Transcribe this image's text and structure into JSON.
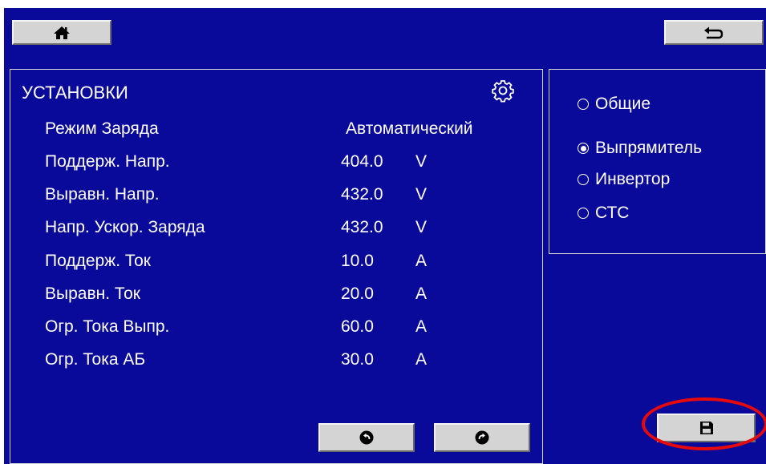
{
  "header": {
    "home_icon": "home-icon",
    "back_icon": "back-arrow-icon"
  },
  "settings": {
    "title": "УСТАНОВКИ",
    "gear_icon": "gear-icon",
    "rows": [
      {
        "label": "Режим Заряда",
        "value": "Автоматический",
        "unit": ""
      },
      {
        "label": "Поддерж. Напр.",
        "value": "404.0",
        "unit": "V"
      },
      {
        "label": "Выравн. Напр.",
        "value": "432.0",
        "unit": "V"
      },
      {
        "label": "Напр. Ускор. Заряда",
        "value": "432.0",
        "unit": "V"
      },
      {
        "label": "Поддерж. Ток",
        "value": "10.0",
        "unit": "A"
      },
      {
        "label": "Выравн. Ток",
        "value": "20.0",
        "unit": "A"
      },
      {
        "label": "Огр. Тока Выпр.",
        "value": "60.0",
        "unit": "A"
      },
      {
        "label": "Огр. Тока АБ",
        "value": "30.0",
        "unit": "A"
      }
    ],
    "prev_icon": "arrow-left-circle-icon",
    "next_icon": "arrow-right-circle-icon"
  },
  "categories": {
    "selected": "Выпрямитель",
    "options": [
      {
        "label": "Общие",
        "selected": false
      },
      {
        "label": "Выпрямитель",
        "selected": true
      },
      {
        "label": "Инвертор",
        "selected": false
      },
      {
        "label": "СТС",
        "selected": false
      }
    ]
  },
  "save_icon": "floppy-disk-icon",
  "colors": {
    "background": "#0a0a9a",
    "button": "#d4d4d4",
    "highlight": "#e80a0a",
    "text": "#ffffff"
  }
}
